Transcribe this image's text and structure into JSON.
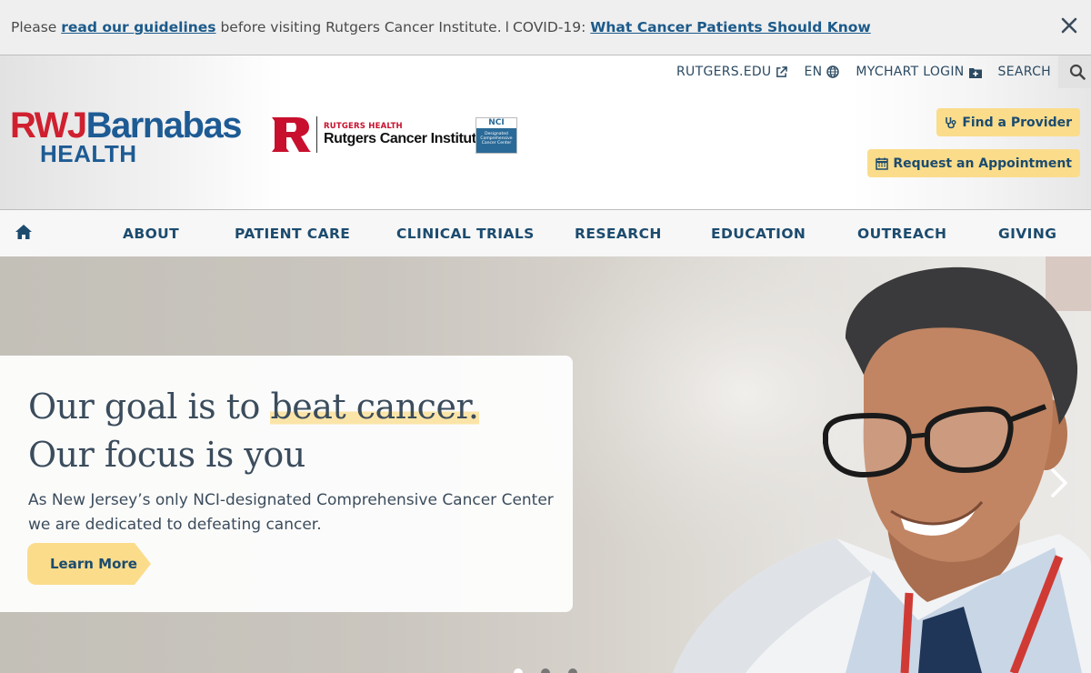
{
  "alert": {
    "prefix": "Please",
    "guidelines_link": "read our guidelines",
    "middle": "before visiting Rutgers Cancer Institute.",
    "separator": "l",
    "covid_prefix": "COVID-19:",
    "covid_link": "What Cancer Patients Should Know"
  },
  "utility": {
    "rutgers": "RUTGERS.EDU",
    "language": "EN",
    "mychart": "MYCHART LOGIN",
    "search": "SEARCH"
  },
  "logos": {
    "rwj_part1": "RWJ",
    "rwj_part2": "Barnabas",
    "rwj_bottom": "HEALTH",
    "rutgers_health": "RUTGERS HEALTH",
    "rutgers_institute": "Rutgers Cancer Institute",
    "nci": "NCI",
    "nci_text": "Designated Comprehensive Cancer Center"
  },
  "cta": {
    "provider": "Find a Provider",
    "appointment": "Request an Appointment"
  },
  "nav": {
    "items": [
      "ABOUT",
      "PATIENT CARE",
      "CLINICAL TRIALS",
      "RESEARCH",
      "EDUCATION",
      "OUTREACH",
      "GIVING"
    ]
  },
  "hero": {
    "line1_prefix": "Our goal is to",
    "line1_highlight": "beat cancer.",
    "line2": "Our focus is you",
    "subtitle": "As New Jersey’s only NCI-designated Comprehensive Cancer Center we are dedicated to defeating cancer.",
    "button": "Learn More"
  },
  "colors": {
    "brand_navy": "#1c4b6e",
    "cta_yellow": "#fadc8b",
    "rwj_red": "#d0202f",
    "rwj_blue": "#1d5b94",
    "rutgers_red": "#c8102e"
  }
}
